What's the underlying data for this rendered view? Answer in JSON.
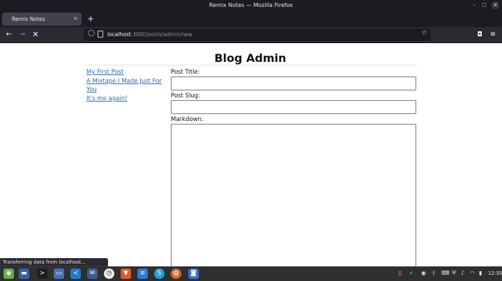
{
  "window": {
    "title": "Remix Notes — Mozilla Firefox",
    "minimize_glyph": "–",
    "maximize_glyph": "□",
    "close_glyph": "×"
  },
  "tabs": [
    {
      "label": "Remix Notes",
      "close_glyph": "×"
    }
  ],
  "new_tab_glyph": "+",
  "nav": {
    "back_icon": "←",
    "forward_icon": "→",
    "stop_icon": "✕",
    "url_host": "localhost",
    "url_path": ":3000/posts/admin/new",
    "bookmark_icon": "☆",
    "shield_icon": "◯",
    "pocket_icon": "◘",
    "menu_icon": "≡"
  },
  "page": {
    "title": "Blog Admin",
    "posts": [
      "My First Post",
      "A Mixtape I Made Just For You",
      "It's me again!"
    ],
    "form": {
      "title_label": "Post Title:",
      "title_value": "",
      "slug_label": "Post Slug:",
      "slug_value": "",
      "markdown_label": "Markdown:",
      "markdown_value": ""
    }
  },
  "status_text": "Transferring data from localhost...",
  "taskbar": {
    "clock": "12:35",
    "apps": [
      {
        "name": "mint-menu-icon",
        "color": "#6aa84f",
        "glyph": "◉"
      },
      {
        "name": "show-desktop-icon",
        "color": "#3b5ea8",
        "glyph": "▬"
      },
      {
        "name": "terminal-icon",
        "color": "#1e1e1e",
        "glyph": ">"
      },
      {
        "name": "files-icon",
        "color": "#4a6fb8",
        "glyph": "▭"
      },
      {
        "name": "vscode-icon",
        "color": "#1f7ad0",
        "glyph": "≺"
      },
      {
        "name": "mail-icon",
        "color": "#3d5a99",
        "glyph": "✉"
      },
      {
        "name": "timeshift-icon",
        "color": "#e8e8e8",
        "glyph": "◷"
      },
      {
        "name": "brave-icon",
        "color": "#e05a2a",
        "glyph": "▼"
      },
      {
        "name": "notes-icon",
        "color": "#2c7bd1",
        "glyph": "≡"
      },
      {
        "name": "skype-icon",
        "color": "#1ca3e0",
        "glyph": "S"
      },
      {
        "name": "firefox-icon",
        "color": "#e06a2c",
        "glyph": "◍"
      },
      {
        "name": "camera-icon",
        "color": "#3a6fc4",
        "glyph": "◙"
      }
    ]
  }
}
